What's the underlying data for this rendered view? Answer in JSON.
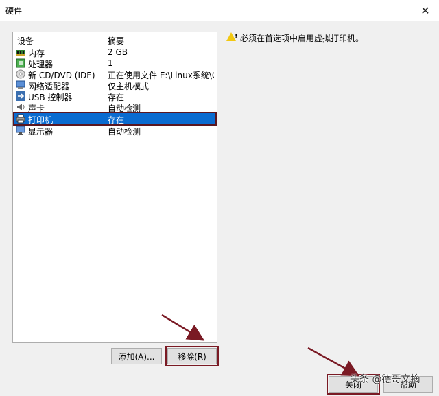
{
  "window": {
    "title": "硬件",
    "close_glyph": "✕"
  },
  "device_list": {
    "columns": {
      "device": "设备",
      "summary": "摘要"
    },
    "rows": [
      {
        "name": "内存",
        "summary": "2 GB",
        "icon": "memory-icon"
      },
      {
        "name": "处理器",
        "summary": "1",
        "icon": "processor-icon"
      },
      {
        "name": "新 CD/DVD (IDE)",
        "summary": "正在使用文件 E:\\Linux系统\\C...",
        "icon": "cd-dvd-icon"
      },
      {
        "name": "网络适配器",
        "summary": "仅主机模式",
        "icon": "network-adapter-icon"
      },
      {
        "name": "USB 控制器",
        "summary": "存在",
        "icon": "usb-icon"
      },
      {
        "name": "声卡",
        "summary": "自动检测",
        "icon": "sound-card-icon"
      },
      {
        "name": "打印机",
        "summary": "存在",
        "icon": "printer-icon",
        "selected": true
      },
      {
        "name": "显示器",
        "summary": "自动检测",
        "icon": "display-icon"
      }
    ]
  },
  "buttons": {
    "add": "添加(A)...",
    "remove": "移除(R)",
    "close": "关闭",
    "help": "帮助"
  },
  "info": {
    "message": "必须在首选项中启用虚拟打印机。",
    "icon": "warning-icon"
  },
  "watermark": "头条 @德哥文摘",
  "colors": {
    "selection": "#0a6bd0",
    "highlight_box": "#7a1a24",
    "arrow": "#7a1a24"
  }
}
